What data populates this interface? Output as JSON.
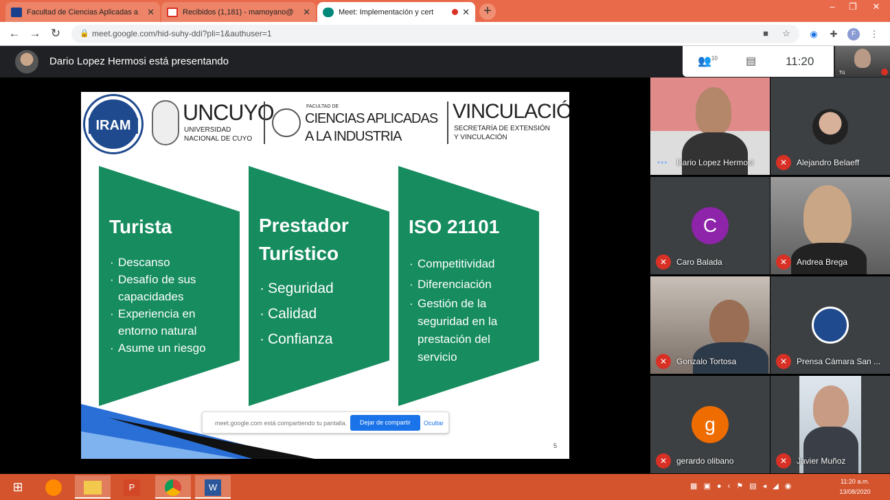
{
  "browser": {
    "tabs": [
      {
        "title": "Facultad de Ciencias Aplicadas a",
        "favicon": "calendar-icon",
        "active": false
      },
      {
        "title": "Recibidos (1,181) - mamoyano@",
        "favicon": "gmail-icon",
        "active": false
      },
      {
        "title": "Meet: Implementación y cert",
        "favicon": "meet-icon",
        "active": true
      }
    ],
    "url": "meet.google.com/hid-suhy-ddi?pli=1&authuser=1",
    "profile_initial": "F"
  },
  "meet": {
    "presenting_text": "Dario Lopez Hermosi está presentando",
    "people_count": "10",
    "time": "11:20",
    "self_label": "Tú",
    "share_bar": {
      "message": "meet.google.com está compartiendo tu pantalla.",
      "stop_label": "Dejar de compartir",
      "hide_label": "Ocultar"
    },
    "participants": [
      {
        "name": "Dario Lopez Hermosi",
        "muted": false,
        "avatar": ""
      },
      {
        "name": "Alejandro Belaeff",
        "muted": true,
        "avatar": ""
      },
      {
        "name": "Caro Balada",
        "muted": true,
        "avatar": "C",
        "avatar_color": "#8e24aa"
      },
      {
        "name": "Andrea Brega",
        "muted": true,
        "avatar": ""
      },
      {
        "name": "Gonzalo Tortosa",
        "muted": true,
        "avatar": ""
      },
      {
        "name": "Prensa Cámara San ...",
        "muted": true,
        "avatar": ""
      },
      {
        "name": "gerardo olibano",
        "muted": true,
        "avatar": "g",
        "avatar_color": "#ef6c00"
      },
      {
        "name": "Javier Muñoz",
        "muted": true,
        "avatar": ""
      }
    ]
  },
  "slide": {
    "logos": {
      "iram": "IRAM",
      "uncuyo": "UNCUYO",
      "uncuyo_sub1": "UNIVERSIDAD",
      "uncuyo_sub2": "NACIONAL DE CUYO",
      "fac_top": "FACULTAD DE",
      "fac_1": "CIENCIAS APLICADAS",
      "fac_2": "A LA INDUSTRIA",
      "vinc": "VINCULACIÓN",
      "vinc_sub1": "SECRETARÍA DE EXTENSIÓN",
      "vinc_sub2": "Y VINCULACIÓN"
    },
    "columns": [
      {
        "title": [
          "Turista"
        ],
        "items": [
          "Descanso",
          "Desafío de sus capacidades",
          "Experiencia en entorno natural",
          "Asume un riesgo"
        ]
      },
      {
        "title": [
          "Prestador",
          "Turístico"
        ],
        "items": [
          "Seguridad",
          "Calidad",
          "Confianza"
        ]
      },
      {
        "title": [
          "ISO 21101"
        ],
        "items": [
          "Competitividad",
          "Diferenciación",
          "Gestión de la seguridad en la prestación del servicio"
        ]
      }
    ],
    "page_number": "5",
    "accent_color": "#168c5f"
  },
  "taskbar": {
    "apps": [
      "start-icon",
      "firefox-icon",
      "file-explorer-icon",
      "powerpoint-icon",
      "chrome-icon",
      "word-icon"
    ],
    "time": "11:20 a.m.",
    "date": "13/08/2020"
  }
}
